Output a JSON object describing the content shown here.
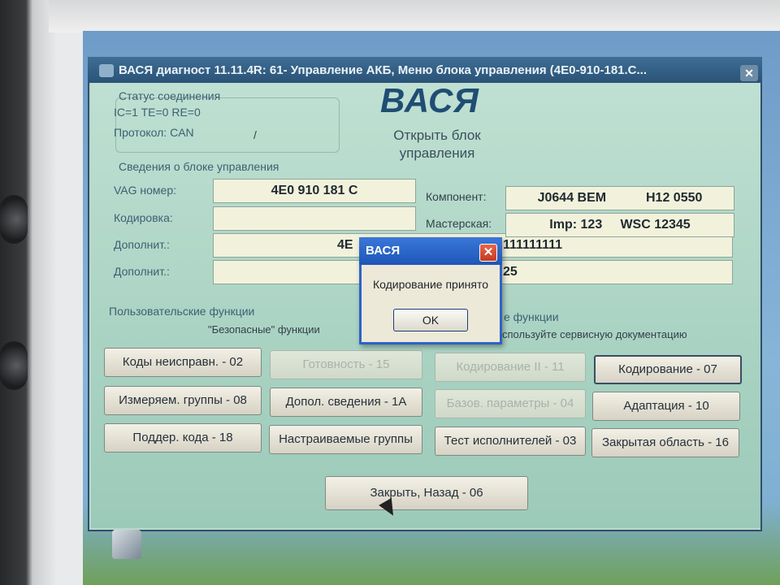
{
  "window": {
    "title": "ВАСЯ диагност 11.11.4R: 61- Управление АКБ, Меню блока управления (4E0-910-181.C..."
  },
  "connection": {
    "heading": "Статус соединения",
    "status_line": "IC=1  TE=0  RE=0",
    "protocol_line": "Протокол: CAN",
    "slash": "/"
  },
  "logo": "ВАСЯ",
  "subtitle": "Открыть блок управления",
  "control_unit": {
    "heading": "Сведения о блоке управления",
    "vag_label": "VAG номер:",
    "vag_value": "4E0 910 181 C",
    "coding_label": "Кодировка:",
    "coding_value": "",
    "extra1_label": "Дополнит.:",
    "extra1_value_left": "4E",
    "extra1_value_right": "111111111",
    "extra2_label": "Дополнит.:",
    "extra2_value_right": "25",
    "component_label": "Компонент:",
    "component_value": "J0644 BEM           H12 0550",
    "workshop_label": "Мастерская:",
    "workshop_value": "Imp: 123     WSC 12345"
  },
  "functions": {
    "user_heading": "Пользовательские функции",
    "user_sub": "\"Безопасные\" функции",
    "advanced_heading": "е функции",
    "advanced_sub": "спользуйте сервисную документацию"
  },
  "buttons": {
    "fault_codes": "Коды неисправн. - 02",
    "readiness": "Готовность - 15",
    "coding2": "Кодирование II - 11",
    "coding": "Кодирование - 07",
    "measuring_groups": "Измеряем. группы - 08",
    "additional_info": "Допол. сведения - 1A",
    "basic_settings": "Базов. параметры - 04",
    "adaptation": "Адаптация - 10",
    "supported_codes": "Поддер. кода - 18",
    "custom_groups": "Настраиваемые группы",
    "output_tests": "Тест исполнителей - 03",
    "security_access": "Закрытая область - 16",
    "close_back": "Закрыть, Назад - 06"
  },
  "dialog": {
    "title": "ВАСЯ",
    "message": "Кодирование принято",
    "ok": "OK"
  }
}
